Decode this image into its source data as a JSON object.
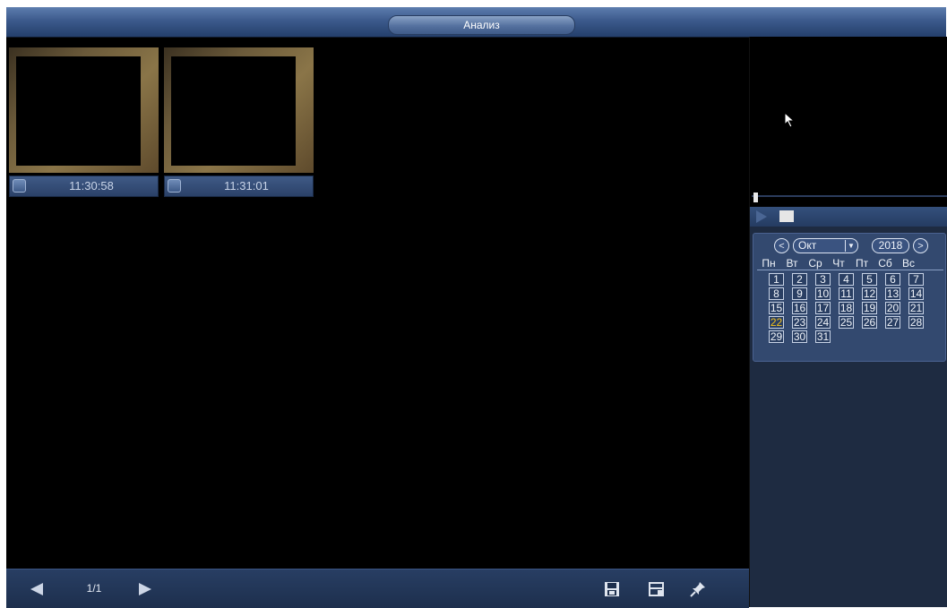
{
  "window": {
    "title": "Анализ"
  },
  "thumbnails": [
    {
      "time": "11:30:58"
    },
    {
      "time": "11:31:01"
    }
  ],
  "pagination": {
    "current": "1/1"
  },
  "toolbar": {
    "icons": [
      "prev-page-icon",
      "next-page-icon",
      "save-icon",
      "save-file-icon",
      "pin-icon"
    ]
  },
  "calendar": {
    "prev_label": "<",
    "next_label": ">",
    "month": "Окт",
    "year": "2018",
    "weekdays": [
      "Пн",
      "Вт",
      "Ср",
      "Чт",
      "Пт",
      "Сб",
      "Вс"
    ],
    "days": [
      "1",
      "2",
      "3",
      "4",
      "5",
      "6",
      "7",
      "8",
      "9",
      "10",
      "11",
      "12",
      "13",
      "14",
      "15",
      "16",
      "17",
      "18",
      "19",
      "20",
      "21",
      "22",
      "23",
      "24",
      "25",
      "26",
      "27",
      "28",
      "29",
      "30",
      "31"
    ],
    "highlighted_day": "22",
    "highlight_color": "#f6c21a"
  },
  "colors": {
    "accent": "#3c5a8c",
    "background": "#000000"
  }
}
